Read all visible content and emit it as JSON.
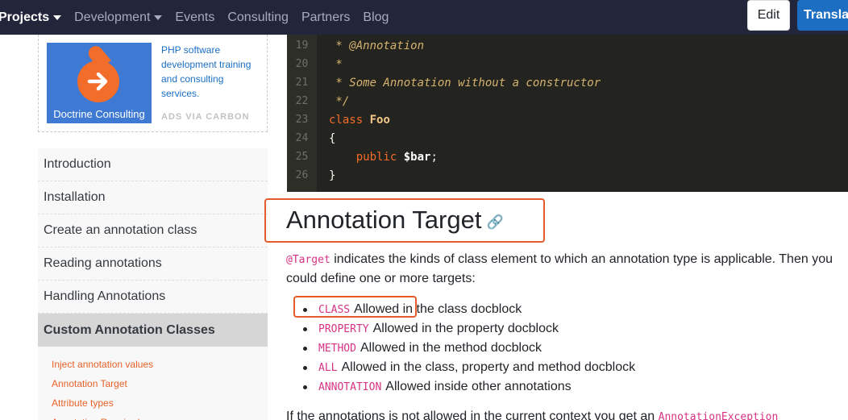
{
  "nav": {
    "items": [
      {
        "label": "Projects",
        "dropdown": true,
        "active": true
      },
      {
        "label": "Development",
        "dropdown": true,
        "active": false
      },
      {
        "label": "Events",
        "dropdown": false,
        "active": false
      },
      {
        "label": "Consulting",
        "dropdown": false,
        "active": false
      },
      {
        "label": "Partners",
        "dropdown": false,
        "active": false
      },
      {
        "label": "Blog",
        "dropdown": false,
        "active": false
      }
    ],
    "edit_label": "Edit",
    "translate_label": "Translate"
  },
  "ad": {
    "image_caption": "Doctrine Consulting",
    "text": "PHP software development training and consulting services.",
    "via": "ADS VIA CARBON"
  },
  "sidebar": {
    "items": [
      {
        "label": "Introduction"
      },
      {
        "label": "Installation"
      },
      {
        "label": "Create an annotation class"
      },
      {
        "label": "Reading annotations"
      },
      {
        "label": "Handling Annotations"
      },
      {
        "label": "Custom Annotation Classes"
      }
    ],
    "sub_items": [
      {
        "label": "Inject annotation values"
      },
      {
        "label": "Annotation Target"
      },
      {
        "label": "Attribute types"
      },
      {
        "label": "Annotation Required"
      }
    ]
  },
  "code": {
    "lines": [
      {
        "n": "19",
        "text": " * @Annotation"
      },
      {
        "n": "20",
        "text": " *"
      },
      {
        "n": "21",
        "text": " * Some Annotation without a constructor"
      },
      {
        "n": "22",
        "text": " */"
      },
      {
        "n": "23",
        "text": "class Foo"
      },
      {
        "n": "24",
        "text": "{"
      },
      {
        "n": "25",
        "text": "    public $bar;"
      },
      {
        "n": "26",
        "text": "}"
      }
    ]
  },
  "content": {
    "heading": "Annotation Target",
    "intro_code": "@Target",
    "intro_text": " indicates the kinds of class element to which an annotation type is applicable. Then you could define one or more targets:",
    "targets": [
      {
        "code": "CLASS",
        "text": "Allowed in the class docblock"
      },
      {
        "code": "PROPERTY",
        "text": "Allowed in the property docblock"
      },
      {
        "code": "METHOD",
        "text": "Allowed in the method docblock"
      },
      {
        "code": "ALL",
        "text": "Allowed in the class, property and method docblock"
      },
      {
        "code": "ANNOTATION",
        "text": "Allowed inside other annotations"
      }
    ],
    "next_text": "If the annotations is not allowed in the current context you get an ",
    "next_code": "AnnotationException"
  }
}
